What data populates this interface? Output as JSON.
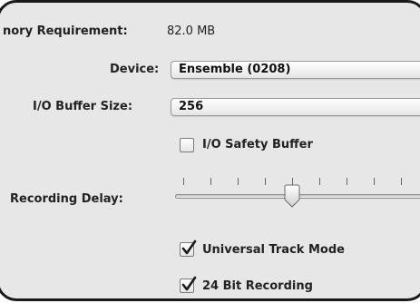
{
  "memory": {
    "label": "nory Requirement:",
    "value": "82.0 MB"
  },
  "device": {
    "label": "Device:",
    "selected": "Ensemble (0208)"
  },
  "buffer": {
    "label": "I/O Buffer Size:",
    "selected": "256"
  },
  "safety_buffer": {
    "label": "I/O Safety Buffer",
    "checked": false
  },
  "recording_delay": {
    "label": "Recording Delay:",
    "tick_count": 9,
    "level_fraction": 0.5
  },
  "universal_track_mode": {
    "label": "Universal Track Mode",
    "checked": true
  },
  "bit_recording": {
    "label": "24 Bit Recording",
    "checked": true
  }
}
